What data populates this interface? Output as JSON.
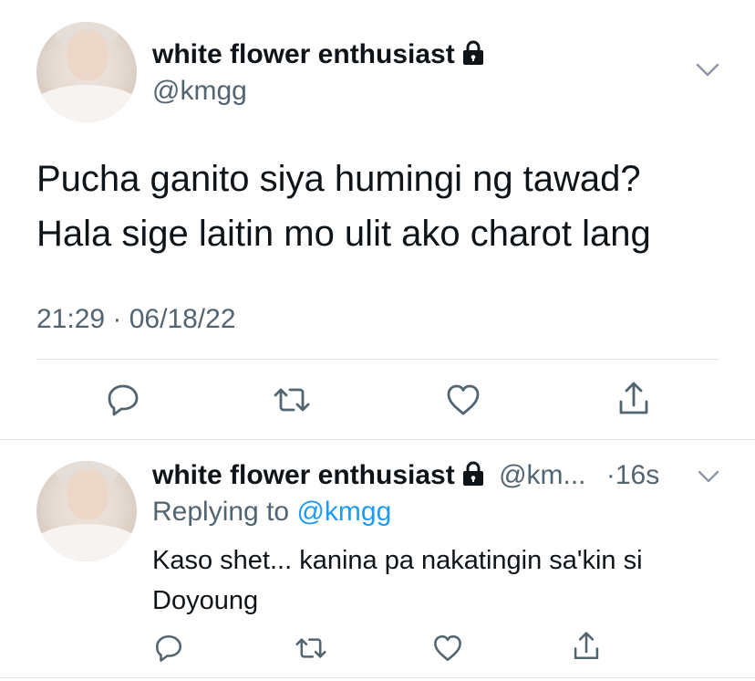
{
  "main_tweet": {
    "author_name": "white flower enthusiast",
    "author_handle": "@kmgg",
    "text_line1": "Pucha ganito siya humingi ng tawad?",
    "text_line2": "Hala sige laitin mo ulit ako charot lang",
    "timestamp": "21:29 · 06/18/22",
    "icons": [
      "reply-icon",
      "retweet-icon",
      "like-icon",
      "share-icon"
    ]
  },
  "reply_tweet": {
    "author_name": "white flower enthusiast",
    "author_handle": "@km...",
    "time": "·16s",
    "replying_prefix": "Replying to",
    "replying_handle": "@kmgg",
    "text_line1": "Kaso shet... kanina pa nakatingin sa'kin si",
    "text_line2": "Doyoung"
  },
  "colors": {
    "accent": "#1d9bf0",
    "text": "#0f1419",
    "secondary": "#536471",
    "divider": "#dfe3e7"
  }
}
